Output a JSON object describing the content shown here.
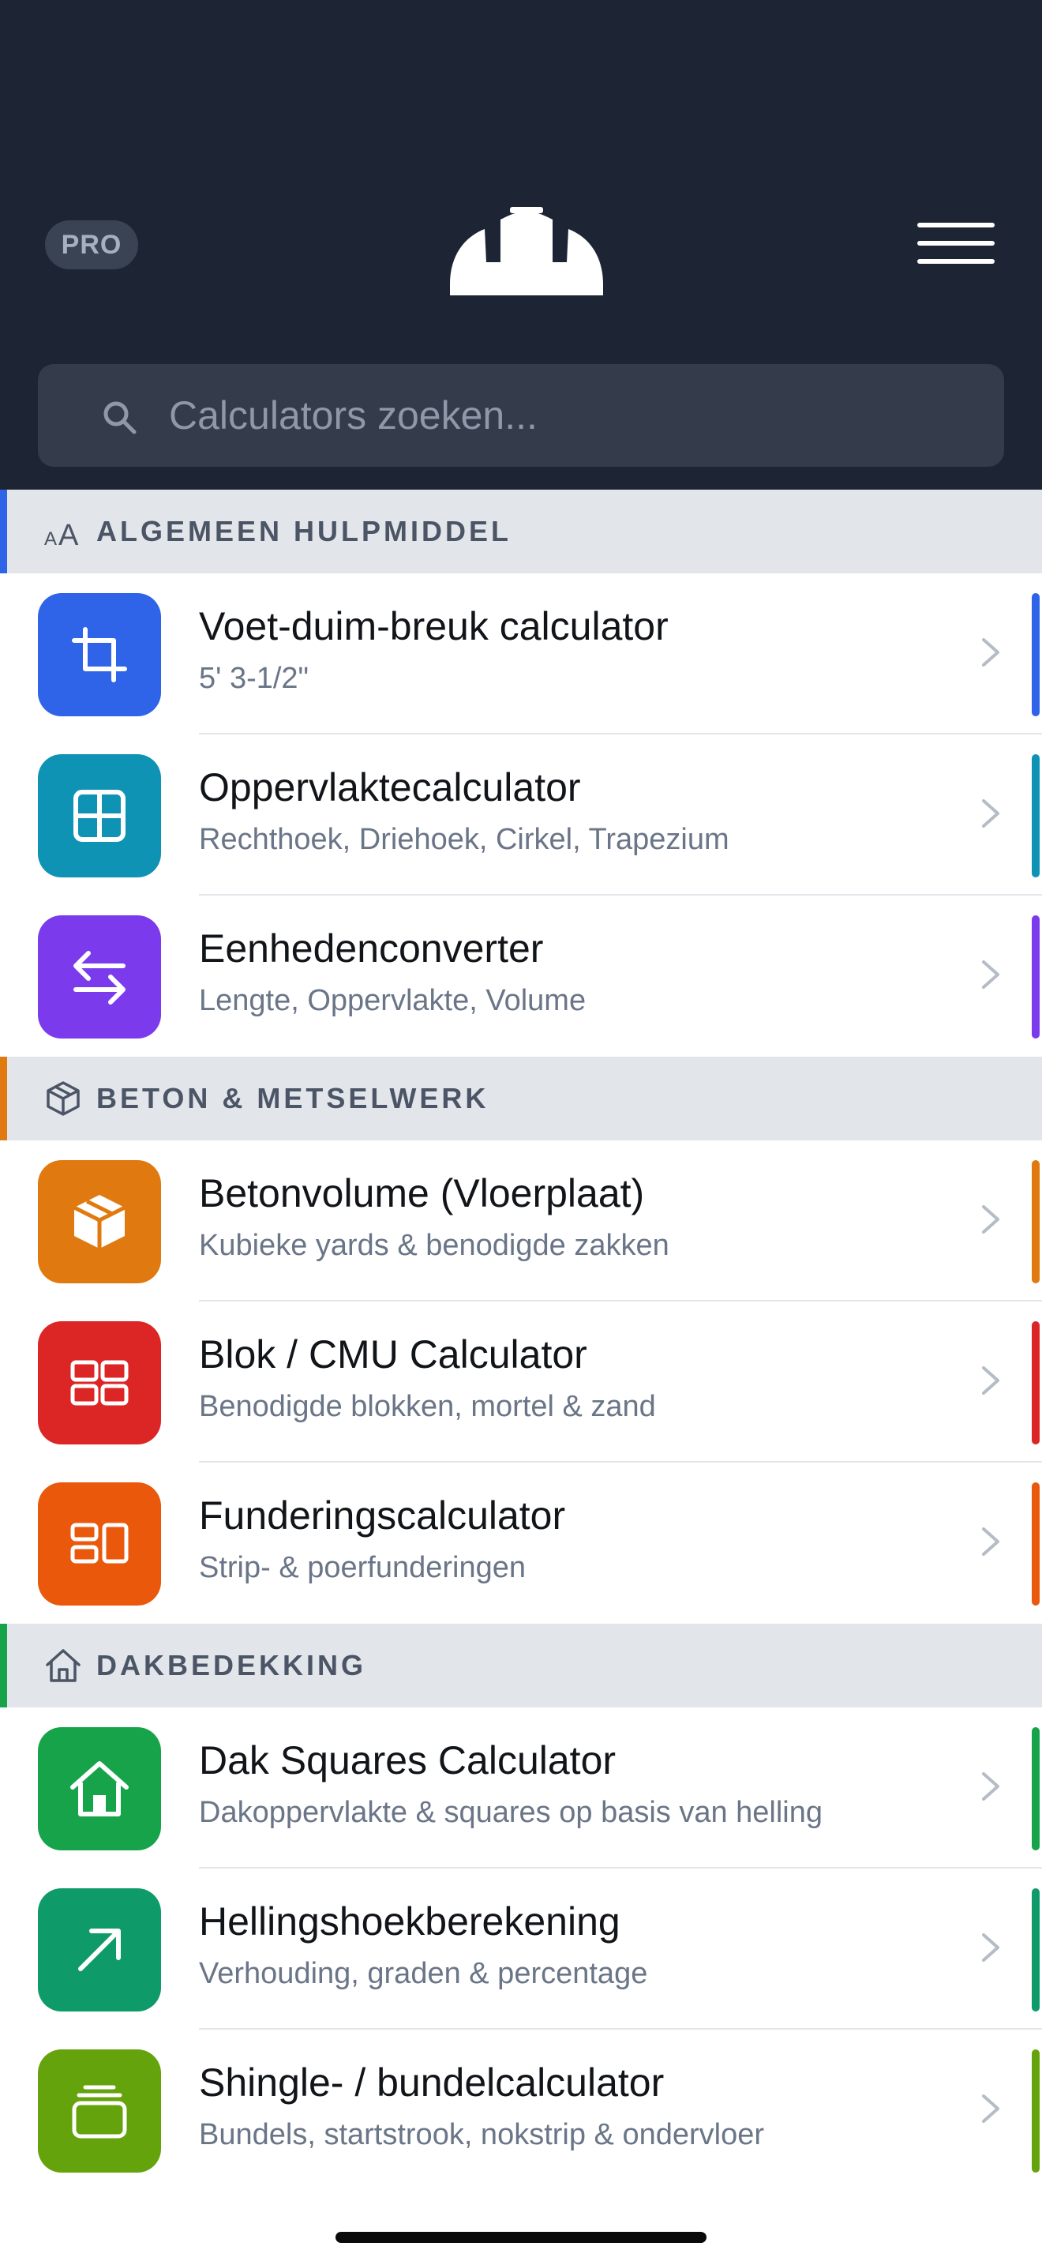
{
  "header": {
    "pro_label": "PRO",
    "logo_icon": "hard-hat-icon",
    "menu_icon": "hamburger-menu-icon",
    "background": "#1d2535"
  },
  "search": {
    "placeholder": "Calculators zoeken...",
    "value": ""
  },
  "sections": [
    {
      "label": "ALGEMEEN HULPMIDDEL",
      "icon": "text-size-icon",
      "accent": "#2f63e8",
      "items": [
        {
          "title": "Voet-duim-breuk calculator",
          "subtitle": "5' 3-1/2\"",
          "icon": "crop-icon",
          "color": "#2f63e8"
        },
        {
          "title": "Oppervlaktecalculator",
          "subtitle": "Rechthoek, Driehoek, Cirkel, Trapezium",
          "icon": "grid-icon",
          "color": "#0f93b4"
        },
        {
          "title": "Eenhedenconverter",
          "subtitle": "Lengte, Oppervlakte, Volume",
          "icon": "swap-arrows-icon",
          "color": "#7c3aed"
        }
      ]
    },
    {
      "label": "BETON & METSELWERK",
      "icon": "box-icon",
      "accent": "#e07a10",
      "items": [
        {
          "title": "Betonvolume (Vloerplaat)",
          "subtitle": "Kubieke yards & benodigde zakken",
          "icon": "box-icon",
          "color": "#e07a10"
        },
        {
          "title": "Blok / CMU Calculator",
          "subtitle": "Benodigde blokken, mortel & zand",
          "icon": "blocks-icon",
          "color": "#dc2626"
        },
        {
          "title": "Funderingscalculator",
          "subtitle": "Strip- & poerfunderingen",
          "icon": "foundation-icon",
          "color": "#ea580c"
        }
      ]
    },
    {
      "label": "DAKBEDEKKING",
      "icon": "house-icon",
      "accent": "#16a34a",
      "items": [
        {
          "title": "Dak Squares Calculator",
          "subtitle": "Dakoppervlakte & squares op basis van helling",
          "icon": "house-icon",
          "color": "#16a34a"
        },
        {
          "title": "Hellingshoekberekening",
          "subtitle": "Verhouding, graden & percentage",
          "icon": "arrow-up-right-icon",
          "color": "#0f9a6a"
        },
        {
          "title": "Shingle- / bundelcalculator",
          "subtitle": "Bundels, startstrook, nokstrip & ondervloer",
          "icon": "stack-icon",
          "color": "#65a30d"
        }
      ]
    }
  ]
}
